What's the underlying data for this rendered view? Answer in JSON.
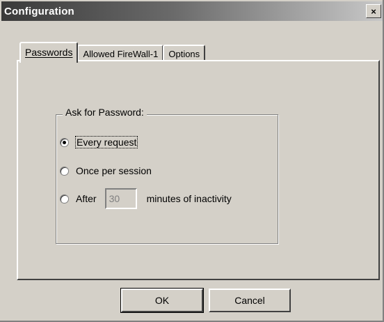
{
  "window": {
    "title": "Configuration",
    "close_glyph": "×"
  },
  "tabs": [
    {
      "label": "Passwords",
      "active": true
    },
    {
      "label": "Allowed FireWall-1",
      "active": false
    },
    {
      "label": "Options",
      "active": false
    }
  ],
  "group": {
    "label": "Ask for Password:",
    "options": [
      {
        "label": "Every request",
        "checked": true
      },
      {
        "label": "Once per session",
        "checked": false
      },
      {
        "label": "After",
        "checked": false
      }
    ],
    "minutes_value": "30",
    "minutes_suffix": "minutes of inactivity"
  },
  "buttons": {
    "ok": "OK",
    "cancel": "Cancel"
  }
}
